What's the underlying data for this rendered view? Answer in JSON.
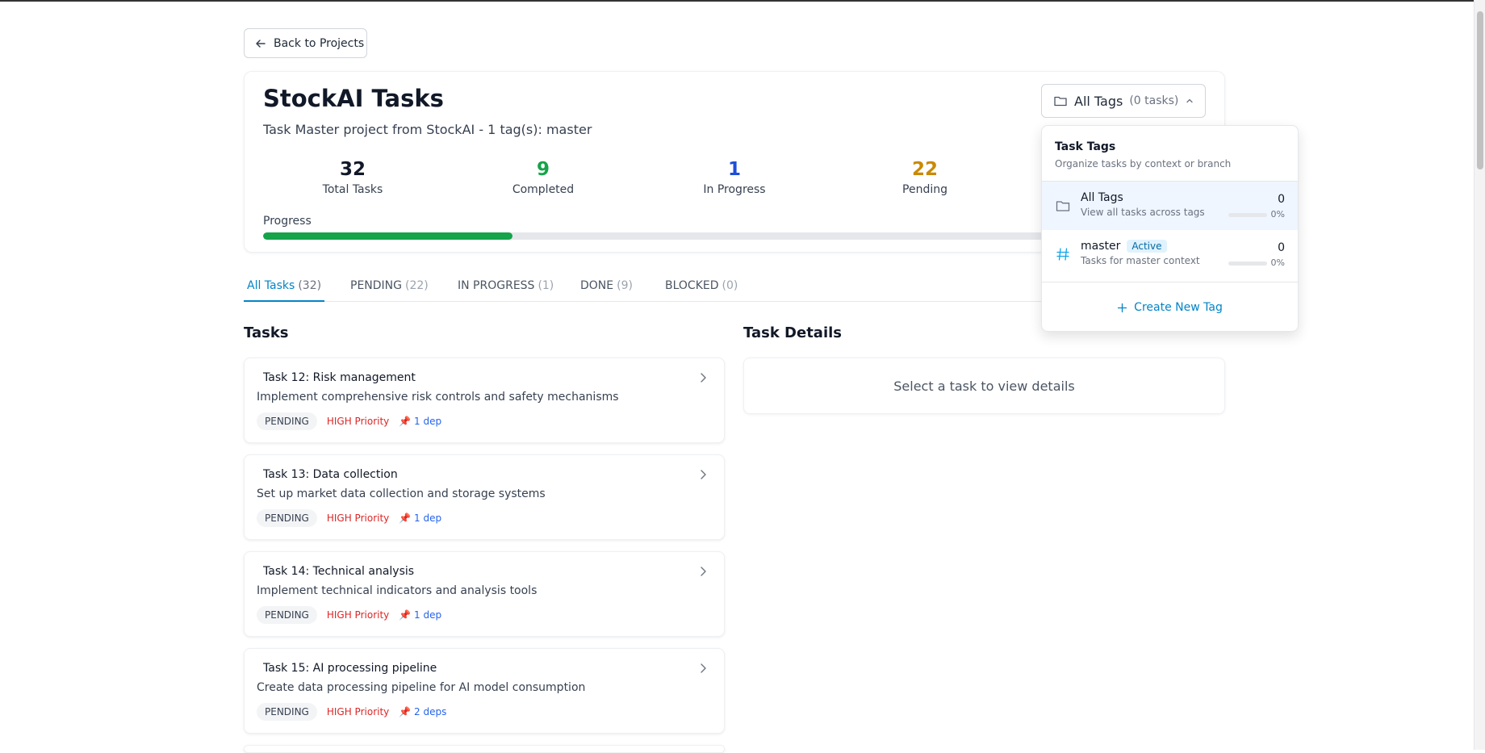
{
  "back_button": {
    "label": "Back to Projects"
  },
  "project": {
    "title": "StockAI Tasks",
    "subtitle": "Task Master project from StockAI - 1 tag(s): master"
  },
  "stats": [
    {
      "value": "32",
      "label": "Total Tasks",
      "color": "#111827"
    },
    {
      "value": "9",
      "label": "Completed",
      "color": "#16a34a"
    },
    {
      "value": "1",
      "label": "In Progress",
      "color": "#1d4ed8"
    },
    {
      "value": "22",
      "label": "Pending",
      "color": "#ca8a04"
    }
  ],
  "progress": {
    "label": "Progress",
    "fraction": 0.2813
  },
  "tag_selector": {
    "label": "All Tags",
    "count": "(0 tasks)"
  },
  "tabs": [
    {
      "label": "All Tasks",
      "count": "(32)"
    },
    {
      "label": "PENDING",
      "count": "(22)"
    },
    {
      "label": "IN PROGRESS",
      "count": "(1)"
    },
    {
      "label": "DONE",
      "count": "(9)"
    },
    {
      "label": "BLOCKED",
      "count": "(0)"
    }
  ],
  "tasks_section": {
    "title": "Tasks"
  },
  "details_section": {
    "title": "Task Details",
    "empty": "Select a task to view details"
  },
  "tasks": [
    {
      "title": "Task 12: Risk management",
      "description": "Implement comprehensive risk controls and safety mechanisms",
      "status": "PENDING",
      "priority": "HIGH Priority",
      "deps": "📌 1 dep"
    },
    {
      "title": "Task 13: Data collection",
      "description": "Set up market data collection and storage systems",
      "status": "PENDING",
      "priority": "HIGH Priority",
      "deps": "📌 1 dep"
    },
    {
      "title": "Task 14: Technical analysis",
      "description": "Implement technical indicators and analysis tools",
      "status": "PENDING",
      "priority": "HIGH Priority",
      "deps": "📌 1 dep"
    },
    {
      "title": "Task 15: AI processing pipeline",
      "description": "Create data processing pipeline for AI model consumption",
      "status": "PENDING",
      "priority": "HIGH Priority",
      "deps": "📌 2 deps"
    }
  ],
  "tag_dropdown": {
    "title": "Task Tags",
    "subtitle": "Organize tasks by context or branch",
    "items": [
      {
        "name": "All Tags",
        "description": "View all tasks across tags",
        "count": "0",
        "percent": "0%",
        "icon": "folder-icon"
      },
      {
        "name": "master",
        "badge": "Active",
        "description": "Tasks for master context",
        "count": "0",
        "percent": "0%",
        "icon": "hash-icon"
      }
    ],
    "create_label": "Create New Tag"
  }
}
